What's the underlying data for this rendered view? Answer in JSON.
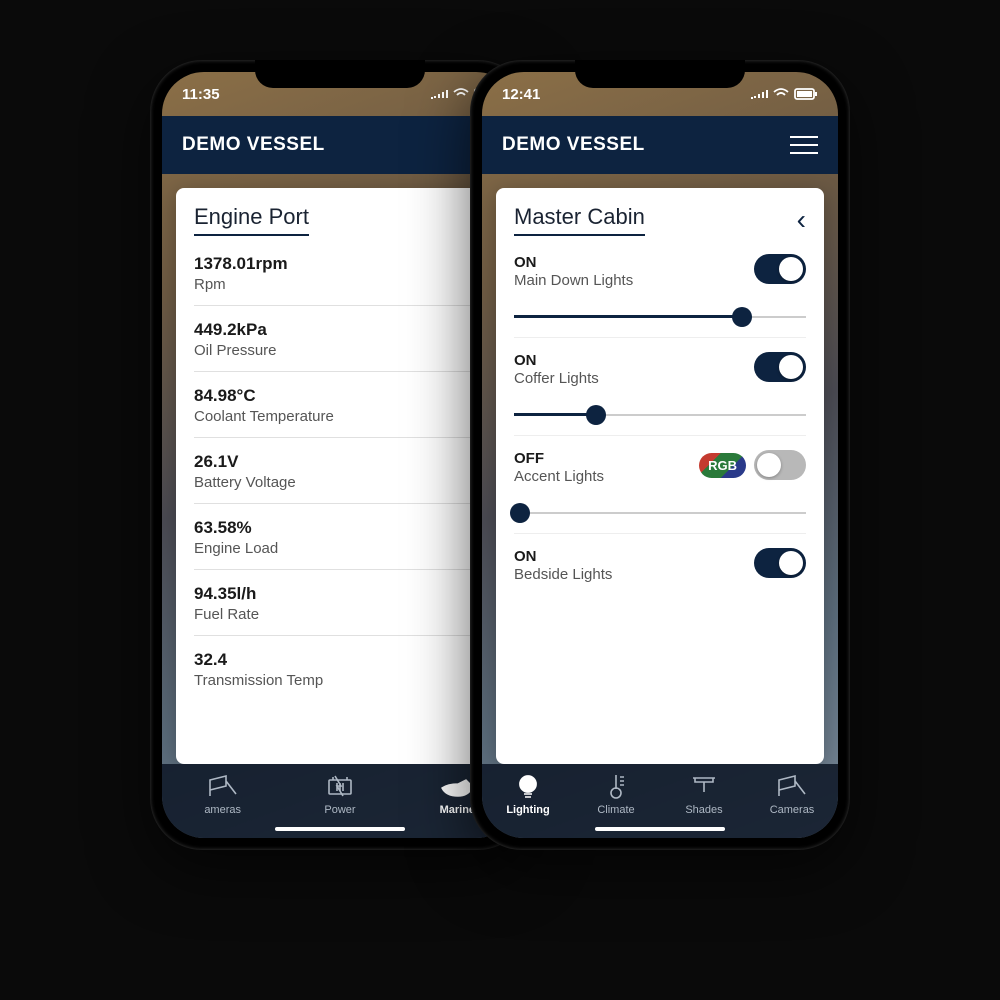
{
  "phoneLeft": {
    "time": "11:35",
    "header": {
      "title": "DEMO VESSEL"
    },
    "card": {
      "title": "Engine Port"
    },
    "metrics": [
      {
        "value": "1378.01rpm",
        "label": "Rpm"
      },
      {
        "value": "449.2kPa",
        "label": "Oil Pressure"
      },
      {
        "value": "84.98°C",
        "label": "Coolant Temperature"
      },
      {
        "value": "26.1V",
        "label": "Battery Voltage"
      },
      {
        "value": "63.58%",
        "label": "Engine Load"
      },
      {
        "value": "94.35l/h",
        "label": "Fuel Rate"
      },
      {
        "value": "32.4",
        "label": "Transmission Temp"
      }
    ],
    "tabs": [
      {
        "label": "ameras",
        "icon": "camera"
      },
      {
        "label": "Power",
        "icon": "battery"
      },
      {
        "label": "Marine",
        "icon": "yacht",
        "active": true
      }
    ]
  },
  "phoneRight": {
    "time": "12:41",
    "header": {
      "title": "DEMO VESSEL"
    },
    "card": {
      "title": "Master Cabin"
    },
    "lights": [
      {
        "state": "ON",
        "name": "Main Down Lights",
        "toggle": true,
        "slider": 78
      },
      {
        "state": "ON",
        "name": "Coffer Lights",
        "toggle": true,
        "slider": 28
      },
      {
        "state": "OFF",
        "name": "Accent Lights",
        "toggle": false,
        "slider": 2,
        "rgb": "RGB"
      },
      {
        "state": "ON",
        "name": "Bedside Lights",
        "toggle": true
      }
    ],
    "tabs": [
      {
        "label": "Lighting",
        "icon": "bulb",
        "active": true
      },
      {
        "label": "Climate",
        "icon": "thermo"
      },
      {
        "label": "Shades",
        "icon": "shade"
      },
      {
        "label": "Cameras",
        "icon": "camera"
      }
    ]
  }
}
